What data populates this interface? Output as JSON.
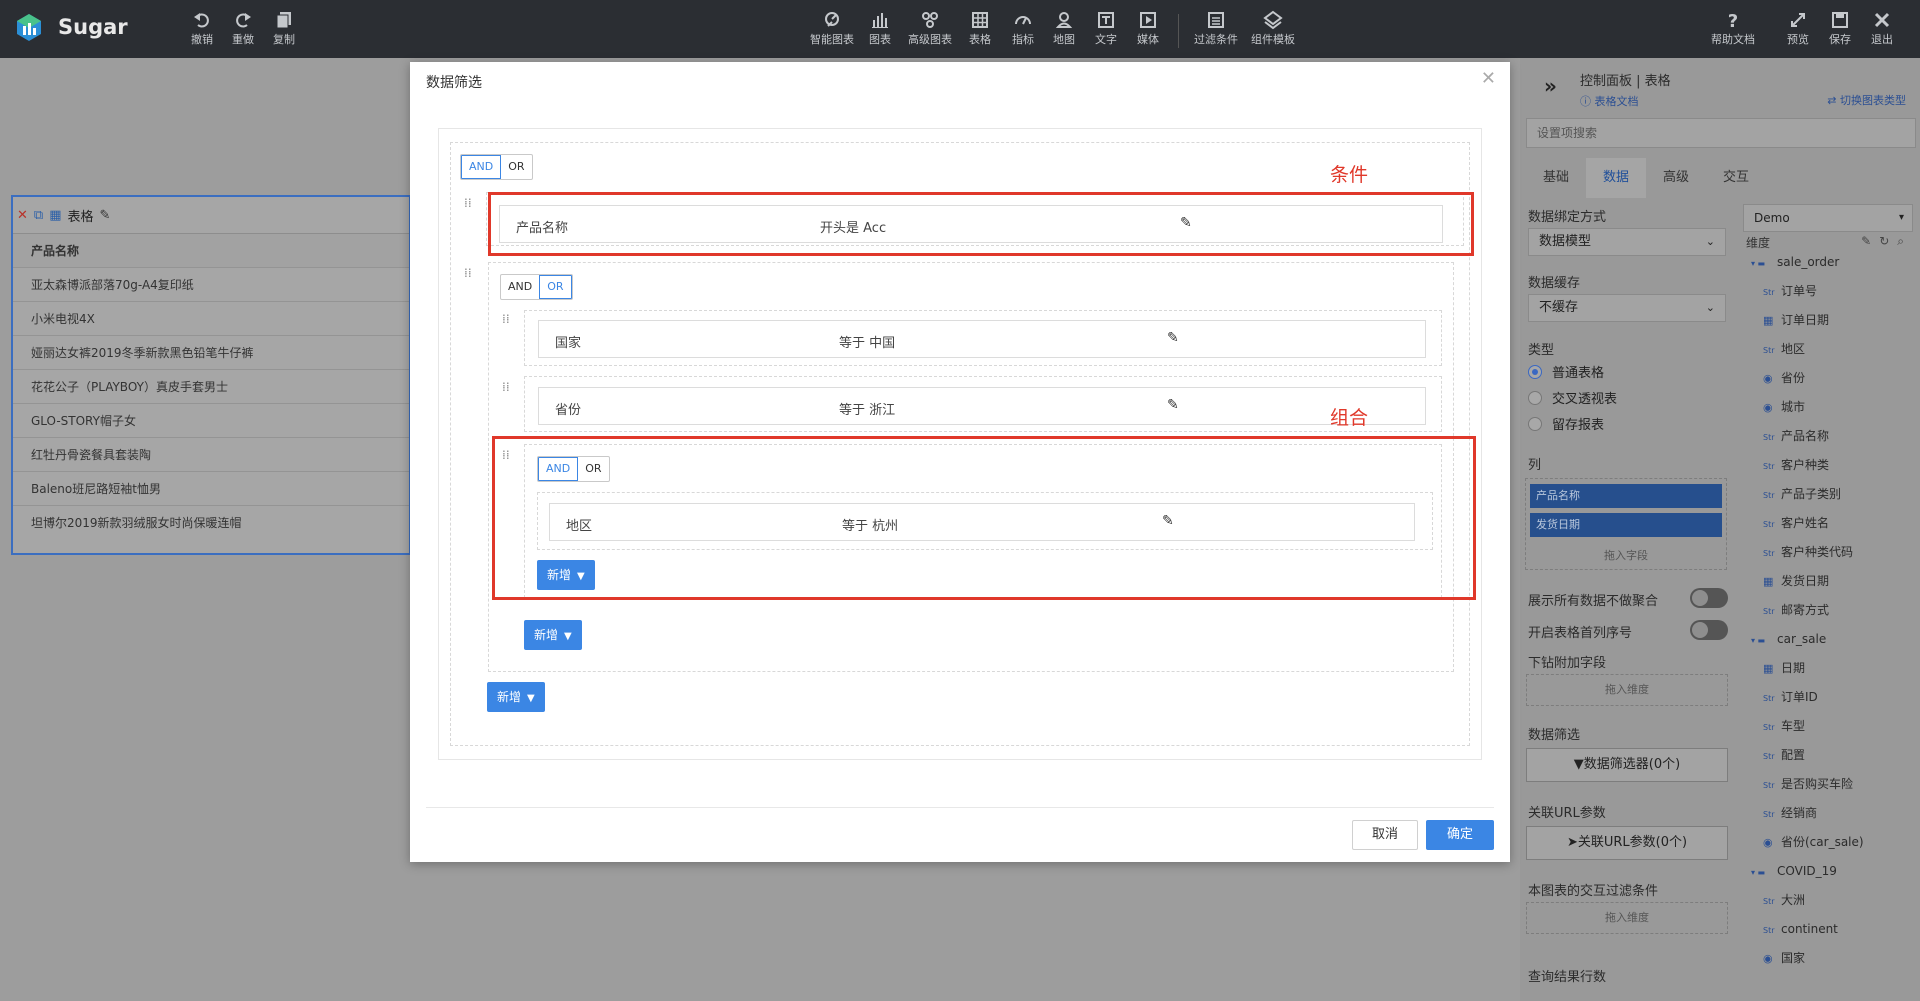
{
  "app": {
    "name": "Sugar"
  },
  "toolbar": {
    "left": [
      {
        "label": "撤销",
        "icon": "undo-icon"
      },
      {
        "label": "重做",
        "icon": "redo-icon"
      },
      {
        "label": "复制",
        "icon": "copy-icon"
      }
    ],
    "center": [
      {
        "label": "智能图表",
        "icon": "smart-chart-icon"
      },
      {
        "label": "图表",
        "icon": "bar-chart-icon"
      },
      {
        "label": "高级图表",
        "icon": "advanced-chart-icon"
      },
      {
        "label": "表格",
        "icon": "table-icon"
      },
      {
        "label": "指标",
        "icon": "gauge-icon"
      },
      {
        "label": "地图",
        "icon": "map-pin-icon"
      },
      {
        "label": "文字",
        "icon": "text-icon"
      },
      {
        "label": "媒体",
        "icon": "media-icon"
      },
      {
        "label": "过滤条件",
        "icon": "filter-icon"
      },
      {
        "label": "组件模板",
        "icon": "component-template-icon"
      }
    ],
    "right": [
      {
        "label": "帮助文档",
        "icon": "help-icon"
      },
      {
        "label": "预览",
        "icon": "expand-icon"
      },
      {
        "label": "保存",
        "icon": "save-icon"
      },
      {
        "label": "退出",
        "icon": "close-icon"
      }
    ]
  },
  "widget": {
    "title": "表格",
    "header": "产品名称",
    "rows": [
      "亚太森博派部落70g-A4复印纸",
      "小米电视4X",
      "娅丽达女裤2019冬季新款黑色铅笔牛仔裤",
      "花花公子（PLAYBOY）真皮手套男士",
      "GLO-STORY帽子女",
      "红牡丹骨瓷餐具套装陶",
      "Baleno班尼路短袖t恤男",
      "坦博尔2019新款羽绒服女时尚保暖连帽"
    ]
  },
  "modal": {
    "title": "数据筛选",
    "root_logic": {
      "and": "AND",
      "or": "OR",
      "selected": "AND"
    },
    "conditions": {
      "c1": {
        "field": "产品名称",
        "op": "开头是 Acc"
      },
      "c2": {
        "field": "国家",
        "op": "等于 中国"
      },
      "c3": {
        "field": "省份",
        "op": "等于 浙江"
      },
      "c4": {
        "field": "地区",
        "op": "等于 杭州"
      }
    },
    "group1_logic": {
      "and": "AND",
      "or": "OR",
      "selected": "OR"
    },
    "group2_logic": {
      "and": "AND",
      "or": "OR",
      "selected": "AND"
    },
    "add_label": "新增",
    "annotations": {
      "condition": "条件",
      "group": "组合"
    },
    "cancel": "取消",
    "confirm": "确定"
  },
  "panel": {
    "title": "控制面板 | 表格",
    "doc_link": "表格文档",
    "switch_chart": "切换图表类型",
    "search_placeholder": "设置项搜索",
    "tabs": [
      "基础",
      "数据",
      "高级",
      "交互"
    ],
    "active_tab": "数据",
    "binding_label": "数据绑定方式",
    "binding_value": "数据模型",
    "cache_label": "数据缓存",
    "cache_value": "不缓存",
    "type_label": "类型",
    "types": [
      "普通表格",
      "交叉透视表",
      "留存报表"
    ],
    "selected_type": "普通表格",
    "columns_label": "列",
    "columns": [
      "产品名称",
      "发货日期"
    ],
    "drop_field": "拖入字段",
    "show_all_label": "展示所有数据不做聚合",
    "row_number_label": "开启表格首列序号",
    "drill_label": "下钻附加字段",
    "drop_dim": "拖入维度",
    "filter_label": "数据筛选",
    "filter_button": "数据筛选器(0个)",
    "url_label": "关联URL参数",
    "url_button": "关联URL参数(0个)",
    "interaction_label": "本图表的交互过滤条件",
    "rows_label": "查询结果行数"
  },
  "datasource": {
    "selected": "Demo",
    "dim_label": "维度",
    "tree": [
      {
        "type": "folder",
        "label": "sale_order"
      },
      {
        "type": "str",
        "label": "订单号"
      },
      {
        "type": "date",
        "label": "订单日期"
      },
      {
        "type": "str",
        "label": "地区"
      },
      {
        "type": "geo",
        "label": "省份"
      },
      {
        "type": "geo",
        "label": "城市"
      },
      {
        "type": "str",
        "label": "产品名称"
      },
      {
        "type": "str",
        "label": "客户种类"
      },
      {
        "type": "str",
        "label": "产品子类别"
      },
      {
        "type": "str",
        "label": "客户姓名"
      },
      {
        "type": "str",
        "label": "客户种类代码"
      },
      {
        "type": "date",
        "label": "发货日期"
      },
      {
        "type": "str",
        "label": "邮寄方式"
      },
      {
        "type": "folder",
        "label": "car_sale"
      },
      {
        "type": "date",
        "label": "日期"
      },
      {
        "type": "str",
        "label": "订单ID"
      },
      {
        "type": "str",
        "label": "车型"
      },
      {
        "type": "str",
        "label": "配置"
      },
      {
        "type": "str",
        "label": "是否购买车险"
      },
      {
        "type": "str",
        "label": "经销商"
      },
      {
        "type": "geo",
        "label": "省份(car_sale)"
      },
      {
        "type": "folder",
        "label": "COVID_19"
      },
      {
        "type": "str",
        "label": "大洲"
      },
      {
        "type": "str",
        "label": "continent"
      },
      {
        "type": "geo",
        "label": "国家"
      }
    ]
  }
}
